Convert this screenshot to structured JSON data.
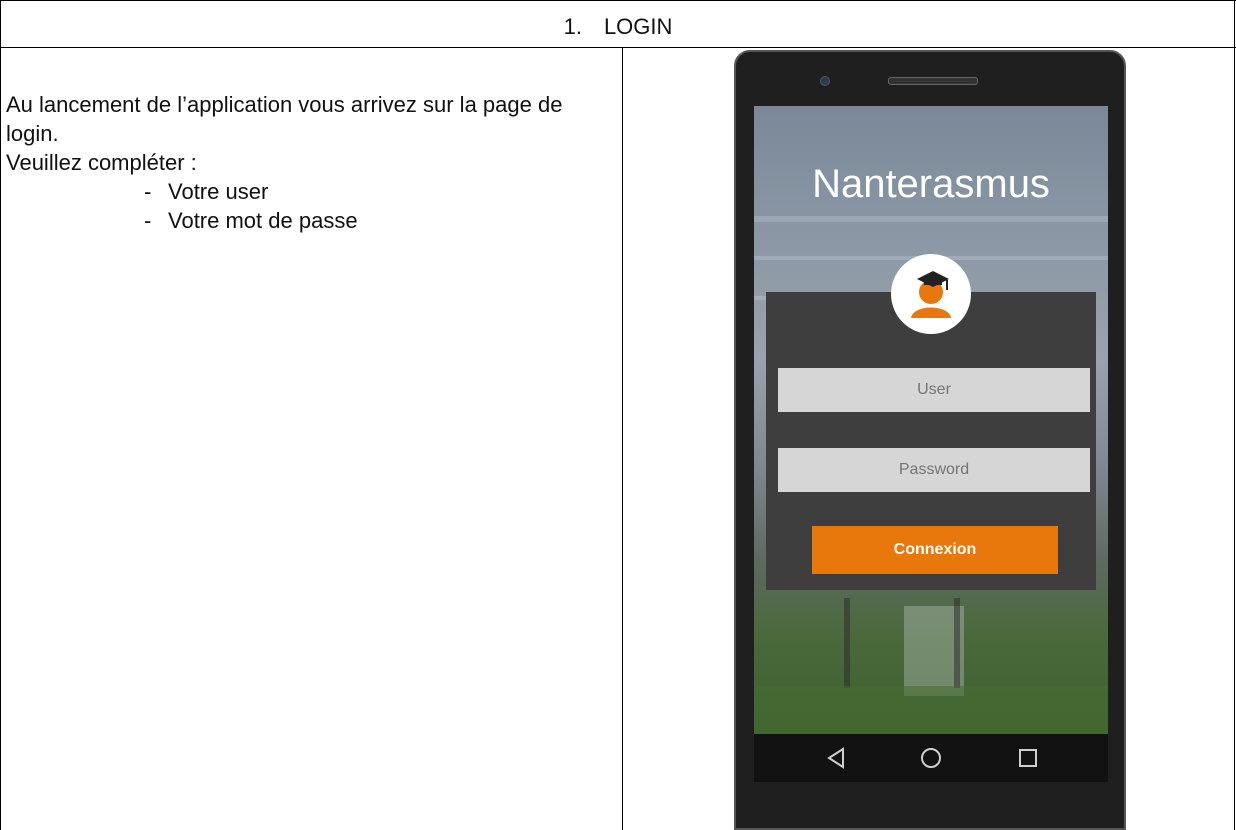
{
  "section": {
    "number": "1.",
    "title": "LOGIN"
  },
  "instructions": {
    "intro": "Au lancement de l’application vous arrivez sur la page de login.",
    "prompt": "Veuillez compléter :",
    "items": [
      {
        "bullet": "-",
        "text": "Votre user"
      },
      {
        "bullet": "-",
        "text": "Votre mot de passe"
      }
    ]
  },
  "app": {
    "title": "Nanterasmus",
    "user_placeholder": "User",
    "password_placeholder": "Password",
    "connect_label": "Connexion"
  },
  "icons": {
    "avatar": "graduate-avatar-icon",
    "nav_back": "triangle-back-icon",
    "nav_home": "circle-home-icon",
    "nav_recent": "square-recent-icon"
  },
  "colors": {
    "accent": "#e8770c",
    "panel": "#3e3e3e",
    "field": "#d6d6d6"
  }
}
